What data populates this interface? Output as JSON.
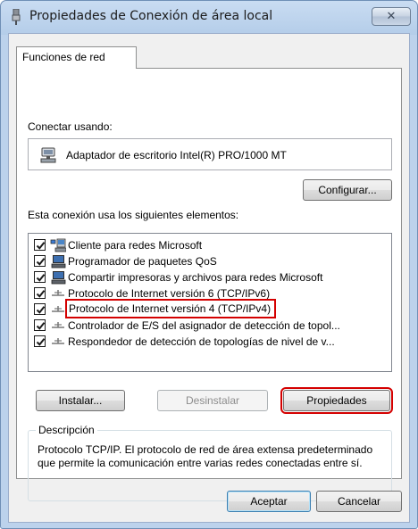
{
  "window": {
    "title": "Propiedades de Conexión de área local",
    "close_symbol": "✕",
    "icon": "network-adapter-icon"
  },
  "tabs": [
    {
      "label": "Funciones de red",
      "selected": true
    }
  ],
  "connect_using": {
    "label": "Conectar usando:",
    "adapter_name": "Adaptador de escritorio Intel(R) PRO/1000 MT",
    "configure_button": "Configurar..."
  },
  "items_label": "Esta conexión usa los siguientes elementos:",
  "items": [
    {
      "label": "Cliente para redes Microsoft",
      "checked": true,
      "icon": "client-network-icon"
    },
    {
      "label": "Programador de paquetes QoS",
      "checked": true,
      "icon": "service-computer-icon"
    },
    {
      "label": "Compartir impresoras y archivos para redes Microsoft",
      "checked": true,
      "icon": "service-computer-icon"
    },
    {
      "label": "Protocolo de Internet versión 6 (TCP/IPv6)",
      "checked": true,
      "icon": "protocol-icon"
    },
    {
      "label": "Protocolo de Internet versión 4 (TCP/IPv4)",
      "checked": true,
      "icon": "protocol-icon",
      "highlighted": true
    },
    {
      "label": "Controlador de E/S del asignador de detección de topol...",
      "checked": true,
      "icon": "protocol-icon"
    },
    {
      "label": "Respondedor de detección de topologías de nivel de v...",
      "checked": true,
      "icon": "protocol-icon"
    }
  ],
  "buttons": {
    "install": "Instalar...",
    "uninstall": "Desinstalar",
    "properties": "Propiedades",
    "accept": "Aceptar",
    "cancel": "Cancelar"
  },
  "description": {
    "title": "Descripción",
    "text": "Protocolo TCP/IP. El protocolo de red de área extensa predeterminado que permite la comunicación entre varias redes conectadas entre sí."
  },
  "colors": {
    "highlight": "#d40000",
    "title_bar": "#b4cde9"
  }
}
